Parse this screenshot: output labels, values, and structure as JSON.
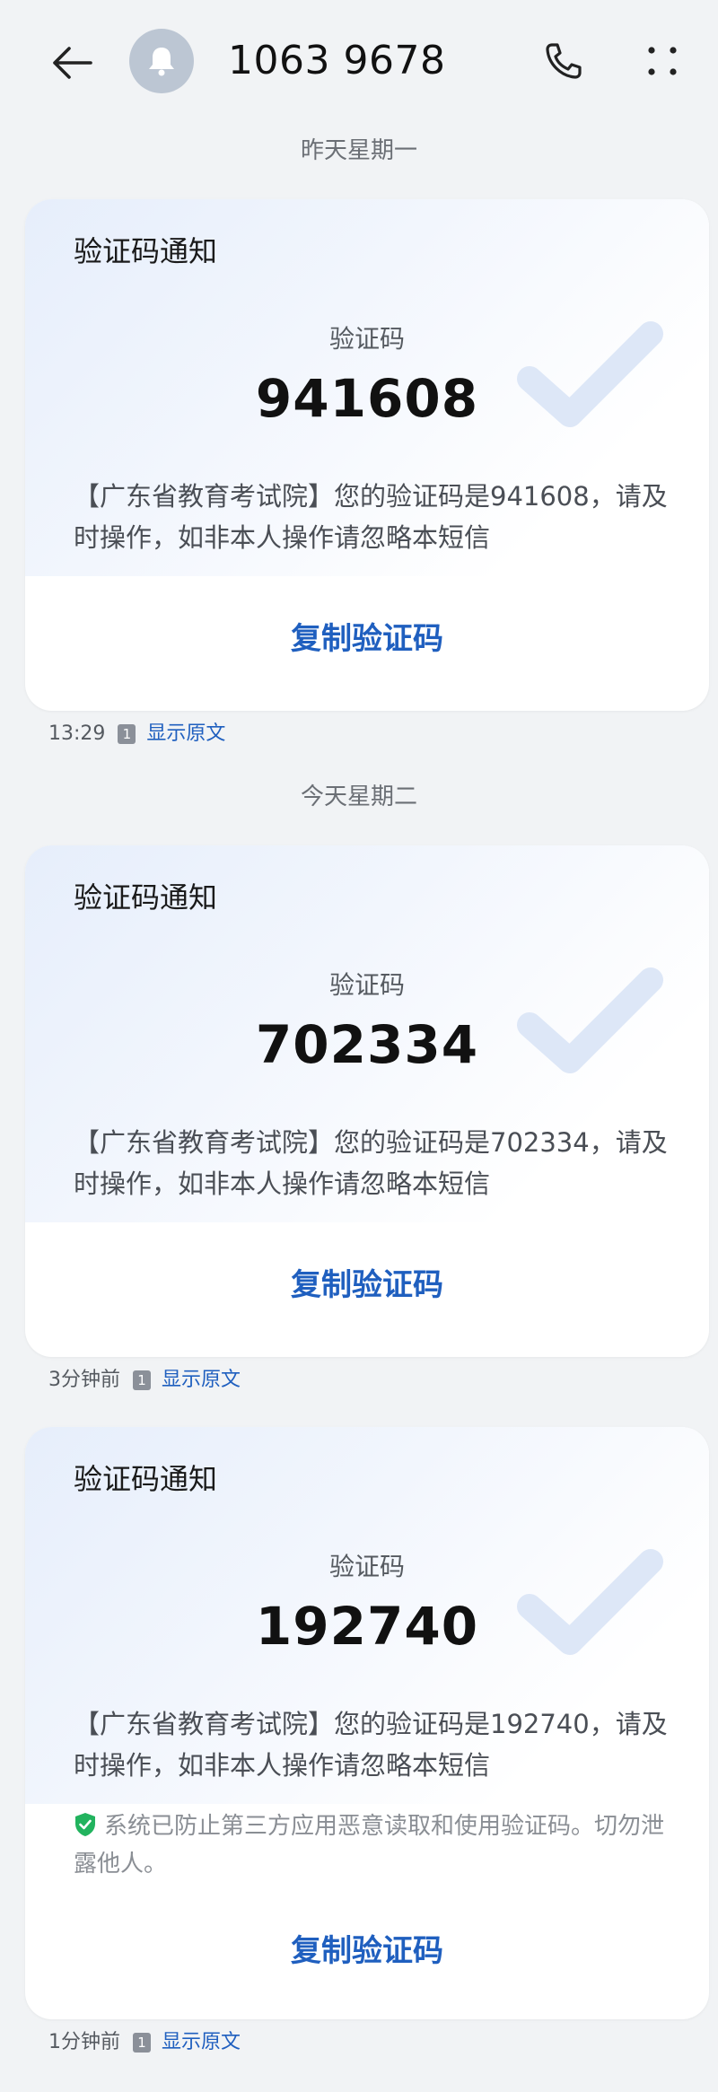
{
  "header": {
    "contact_number": "1063 9678",
    "icons": {
      "back": "back-arrow-icon",
      "avatar": "bell-icon",
      "call": "phone-icon",
      "more": "more-vertical-icon"
    }
  },
  "date_separators": [
    "昨天星期一",
    "今天星期二"
  ],
  "messages": [
    {
      "title": "验证码通知",
      "code_label": "验证码",
      "code": "941608",
      "body": "【广东省教育考试院】您的验证码是941608，请及时操作，如非本人操作请忽略本短信",
      "copy_label": "复制验证码",
      "time": "13:29",
      "sim": "1",
      "show_original": "显示原文"
    },
    {
      "title": "验证码通知",
      "code_label": "验证码",
      "code": "702334",
      "body": "【广东省教育考试院】您的验证码是702334，请及时操作，如非本人操作请忽略本短信",
      "copy_label": "复制验证码",
      "time": "3分钟前",
      "sim": "1",
      "show_original": "显示原文"
    },
    {
      "title": "验证码通知",
      "code_label": "验证码",
      "code": "192740",
      "body": "【广东省教育考试院】您的验证码是192740，请及时操作，如非本人操作请忽略本短信",
      "security_note": "系统已防止第三方应用恶意读取和使用验证码。切勿泄露他人。",
      "copy_label": "复制验证码",
      "time": "1分钟前",
      "sim": "1",
      "show_original": "显示原文"
    }
  ],
  "colors": {
    "accent": "#1f5fbf",
    "background": "#f1f3f5",
    "shield": "#22b35e"
  }
}
